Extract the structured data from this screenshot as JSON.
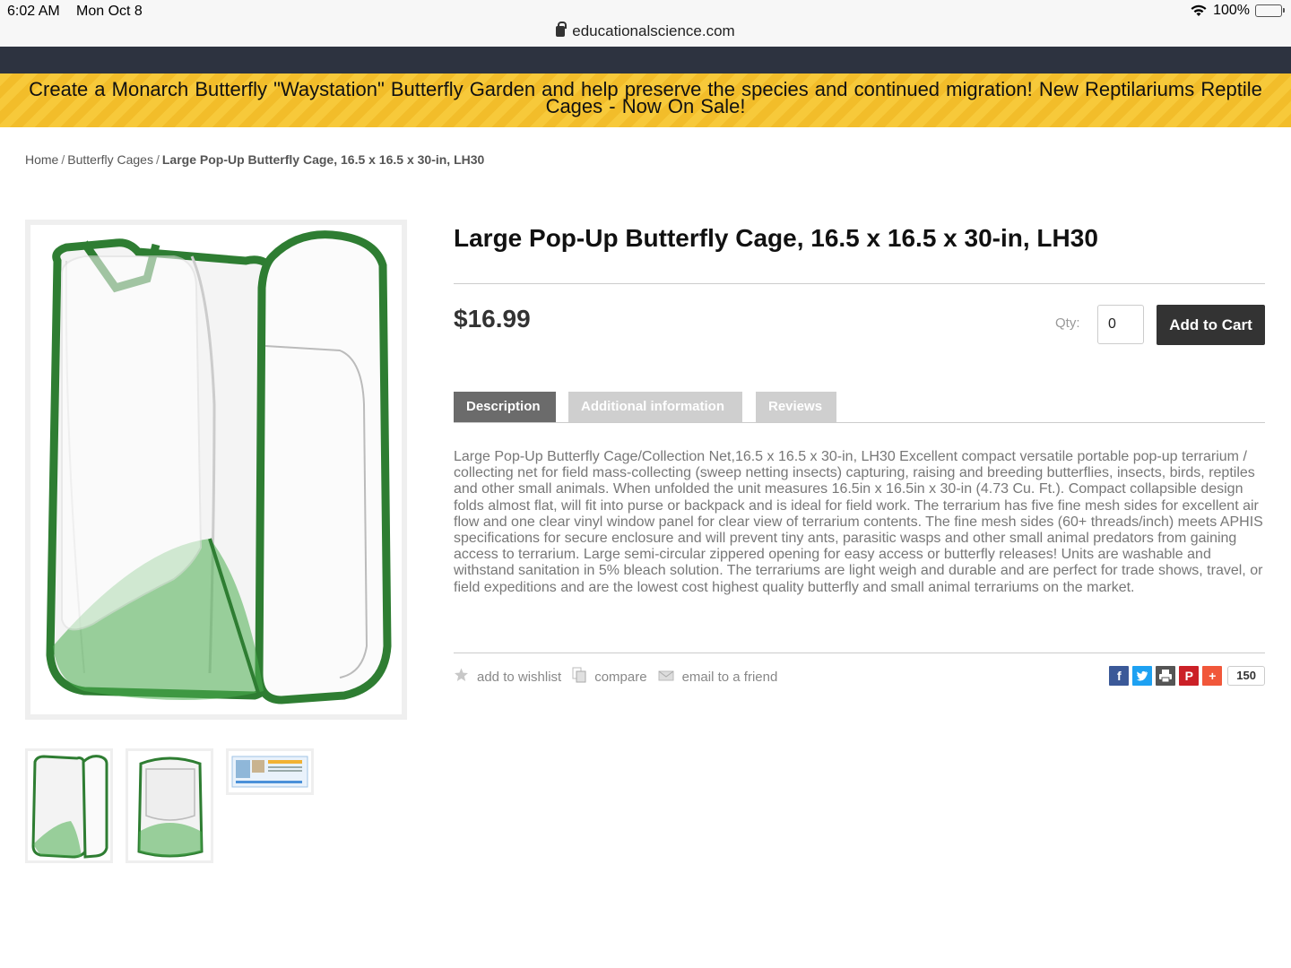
{
  "status": {
    "time": "6:02 AM",
    "date": "Mon Oct 8",
    "url": "educationalscience.com",
    "battery": "100%"
  },
  "banner": {
    "text": "Create a Monarch Butterfly \"Waystation\" Butterfly Garden and help preserve the species and continued migration!     New Reptilariums Reptile Cages - Now On Sale!"
  },
  "breadcrumb": {
    "home": "Home",
    "category": "Butterfly Cages",
    "current": "Large Pop-Up Butterfly Cage, 16.5 x 16.5 x 30-in, LH30"
  },
  "product": {
    "title": "Large Pop-Up Butterfly Cage, 16.5 x 16.5 x 30-in, LH30",
    "price": "$16.99",
    "qty_label": "Qty:",
    "qty_value": "0",
    "add_to_cart": "Add to Cart"
  },
  "tabs": [
    {
      "label": "Description",
      "active": true
    },
    {
      "label": "Additional information",
      "active": false
    },
    {
      "label": "Reviews",
      "active": false
    }
  ],
  "description": "Large Pop-Up Butterfly Cage/Collection Net,16.5 x 16.5 x 30-in, LH30 Excellent compact versatile portable pop-up terrarium / collecting net for field mass-collecting (sweep netting insects) capturing, raising and breeding butterflies, insects, birds, reptiles and other small animals. When unfolded the unit measures 16.5in x 16.5in x 30-in (4.73 Cu. Ft.). Compact collapsible design folds almost flat, will fit into purse or backpack and is ideal for field work. The terrarium has five fine mesh sides for excellent air flow and one clear vinyl window panel for clear view of terrarium contents. The fine mesh sides (60+ threads/inch) meets APHIS specifications for secure enclosure and will prevent tiny ants, parasitic wasps and other small animal predators from gaining access to terrarium. Large semi-circular zippered opening for easy access or butterfly releases! Units are washable and withstand sanitation in 5% bleach solution. The terrariums are light weigh and durable and are perfect for trade shows, travel, or field expeditions and are the lowest cost highest quality butterfly and small animal terrariums on the market.",
  "actions": {
    "wishlist": "add to wishlist",
    "compare": "compare",
    "email": "email to a friend"
  },
  "share": {
    "count": "150"
  },
  "colors": {
    "banner": "#f7c93a",
    "topbar": "#2d3340",
    "cart_button": "#333333",
    "cage_green": "#2e7d32"
  }
}
